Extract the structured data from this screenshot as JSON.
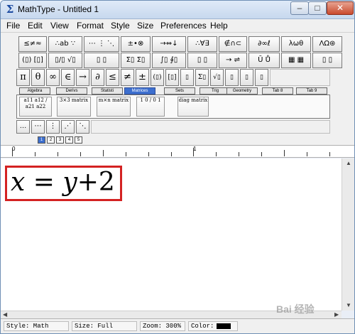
{
  "window": {
    "title": "MathType - Untitled 1",
    "app_icon": "Σ"
  },
  "window_controls": {
    "minimize": "–",
    "maximize": "□",
    "close": "✕"
  },
  "menu": [
    "File",
    "Edit",
    "View",
    "Format",
    "Style",
    "Size",
    "Preferences",
    "Help"
  ],
  "palette_row1": [
    "≤≠≈",
    "∴ab ∵",
    "⋯ ⋮ ⋱",
    "±•⊗",
    "→⇔↓",
    "∴∀∃",
    "∉∩⊂",
    "∂∞ℓ",
    "λωθ",
    "ΛΩ⊛"
  ],
  "palette_row2": [
    "(▯) [▯]",
    "▯/▯ √▯",
    "▯ ▯",
    "Σ▯ Σ▯",
    "∫▯ ∮▯",
    "▯ ▯",
    "→ ⇌",
    "Ū Ů",
    "▦ ▦",
    "▯ ▯"
  ],
  "palette_row3": [
    "π",
    "θ",
    "∞",
    "∈",
    "→",
    "∂",
    "≤",
    "≠",
    "±",
    "(▯)",
    "[▯]",
    "▯",
    "Σ▯",
    "√▯",
    "▯",
    "▯",
    "▯"
  ],
  "tabs": [
    "Algebra",
    "Derivs",
    "Statisti",
    "Matrices",
    "Sets",
    "Trig",
    "Geometry",
    "Tab 8",
    "Tab 9"
  ],
  "active_tab": "Matrices",
  "templates": [
    "a11 a12 / a21 a22",
    "3×3 matrix",
    "m×n matrix",
    "1 0 / 0 1",
    "diag matrix"
  ],
  "dot_buttons": [
    "…",
    "⋯",
    "⋮",
    "⋰",
    "⋱"
  ],
  "size_buttons": [
    "1",
    "2",
    "3",
    "4",
    "5"
  ],
  "ruler": {
    "marks": [
      "0",
      "1"
    ]
  },
  "equation": {
    "x": "x",
    "eq": "=",
    "y": "y",
    "plus": "+",
    "two": "2"
  },
  "status": {
    "style": "Style: Math",
    "size": "Size: Full",
    "zoom": "Zoom: 300%",
    "color_label": "Color:",
    "color_value": "#000000"
  },
  "watermark": "Bai 经验"
}
